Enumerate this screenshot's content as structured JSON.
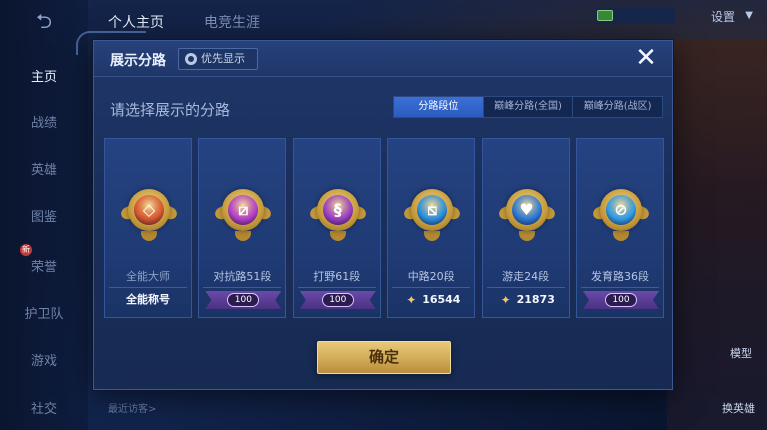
{
  "background": {
    "nav": {
      "back_icon": "back-arrow-icon",
      "items": [
        {
          "label": "主页",
          "active": true
        },
        {
          "label": "战绩",
          "active": false
        },
        {
          "label": "英雄",
          "active": false
        },
        {
          "label": "图鉴",
          "active": false
        },
        {
          "label": "荣誉",
          "active": false,
          "badge": "新"
        },
        {
          "label": "护卫队",
          "active": false
        },
        {
          "label": "游戏",
          "active": false
        },
        {
          "label": "社交",
          "active": false
        }
      ]
    },
    "top_tabs": [
      {
        "label": "个人主页",
        "active": true
      },
      {
        "label": "电竞生涯",
        "active": false
      }
    ],
    "settings_label": "设置",
    "side_labels": {
      "model": "模型",
      "change_hero": "换英雄"
    },
    "visitors_label": "最近访客>"
  },
  "modal": {
    "title": "展示分路",
    "priority_button": "优先显示",
    "close_icon": "close-icon",
    "subtitle": "请选择展示的分路",
    "segments": [
      {
        "label": "分路段位",
        "active": true
      },
      {
        "label": "巅峰分路(全国)",
        "active": false
      },
      {
        "label": "巅峰分路(战区)",
        "active": false
      }
    ],
    "cards": [
      {
        "label": "全能大师",
        "foot_type": "text",
        "foot": "全能称号",
        "glyph": "◇",
        "core_color": "#d9572e",
        "dim": true
      },
      {
        "label": "对抗路51段",
        "foot_type": "plaque",
        "foot": "100",
        "glyph": "⧄",
        "core_color": "#b43fc9",
        "dim": false
      },
      {
        "label": "打野61段",
        "foot_type": "plaque",
        "foot": "100",
        "glyph": "§",
        "core_color": "#9b3ec6",
        "dim": false
      },
      {
        "label": "中路20段",
        "foot_type": "score",
        "foot": "16544",
        "glyph": "⧅",
        "core_color": "#2a8fe0",
        "dim": false
      },
      {
        "label": "游走24段",
        "foot_type": "score",
        "foot": "21873",
        "glyph": "♥",
        "core_color": "#2a7ad8",
        "dim": false
      },
      {
        "label": "发育路36段",
        "foot_type": "plaque",
        "foot": "100",
        "glyph": "⊘",
        "core_color": "#2f9be8",
        "dim": false
      }
    ],
    "confirm_button": "确定"
  }
}
